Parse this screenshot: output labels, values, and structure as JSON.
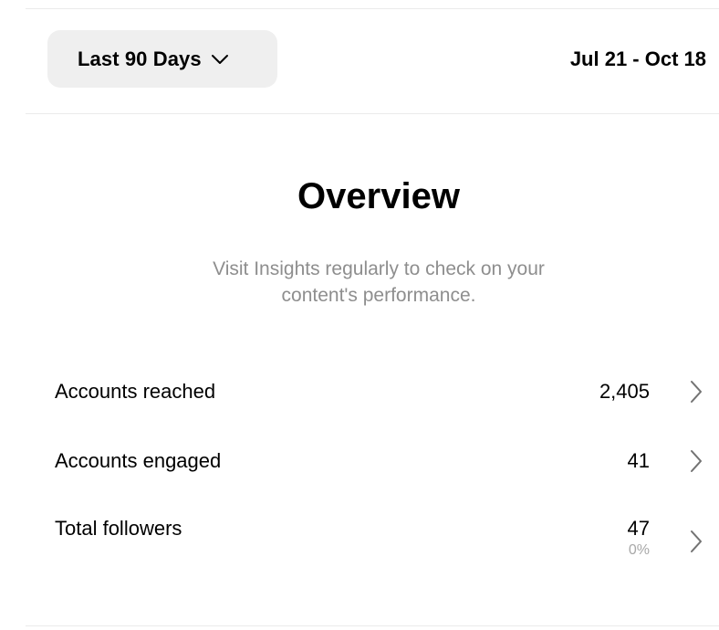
{
  "header": {
    "range_label": "Last 90 Days",
    "date_range": "Jul 21 - Oct 18"
  },
  "overview": {
    "title": "Overview",
    "subtitle_line1": "Visit Insights regularly to check on your",
    "subtitle_line2": "content's performance."
  },
  "metrics": [
    {
      "label": "Accounts reached",
      "value": "2,405"
    },
    {
      "label": "Accounts engaged",
      "value": "41"
    },
    {
      "label": "Total followers",
      "value": "47",
      "change": "0%"
    }
  ],
  "icons": {
    "range_dropdown": "chevron-down-icon",
    "row_arrow": "chevron-right-icon"
  },
  "colors": {
    "background": "#ffffff",
    "button_background": "#efefef",
    "secondary_text": "#8e8e8e",
    "chevron": "#737373"
  }
}
